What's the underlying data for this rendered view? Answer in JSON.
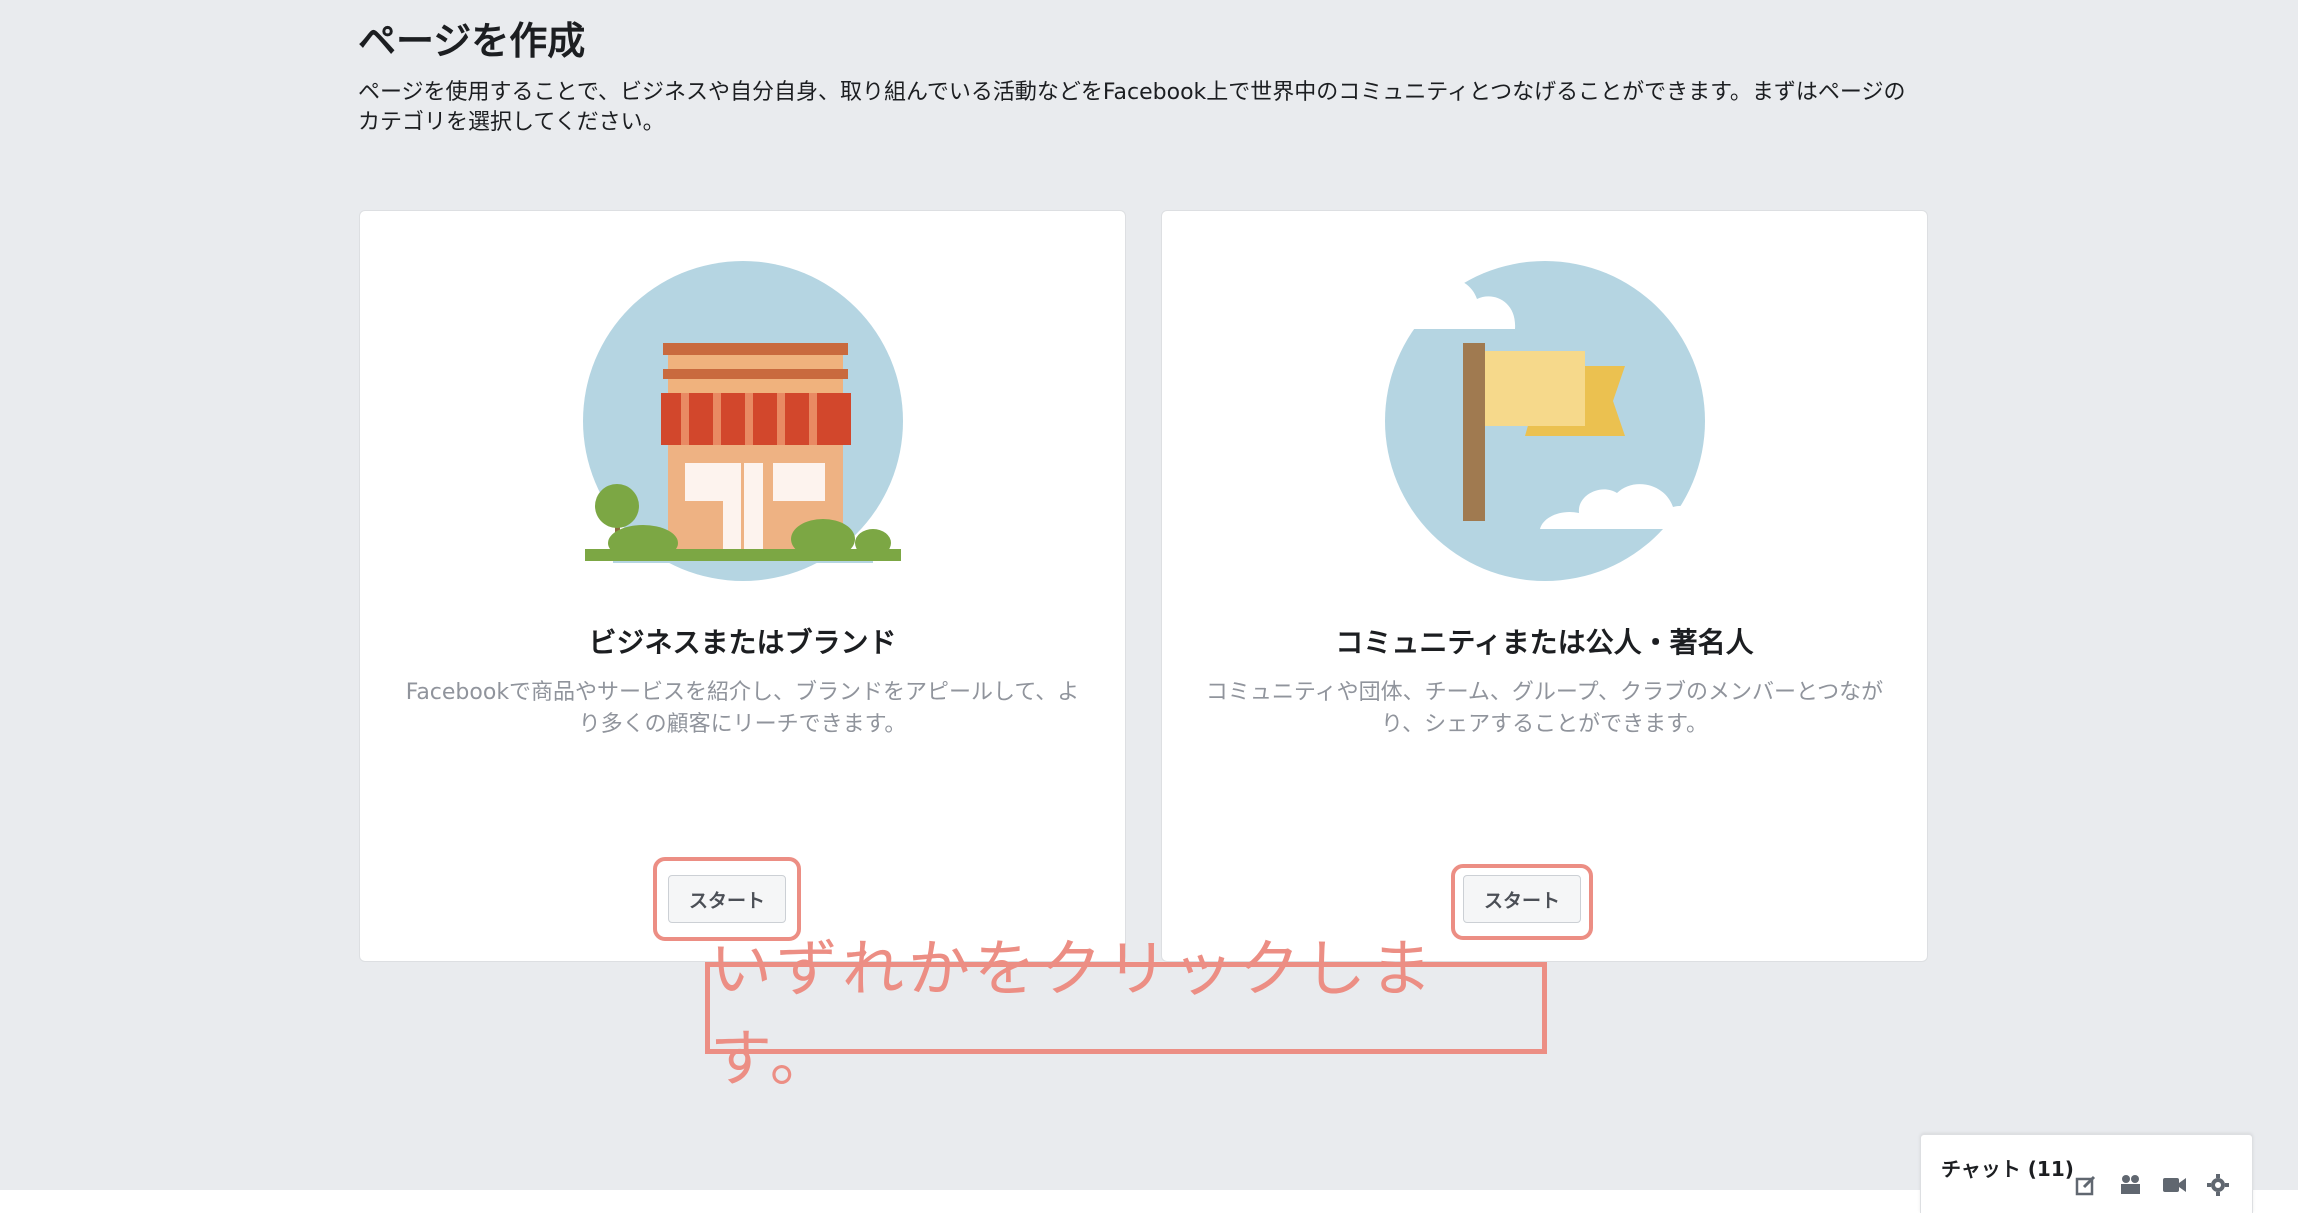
{
  "header": {
    "title": "ページを作成",
    "description": "ページを使用することで、ビジネスや自分自身、取り組んでいる活動などをFacebook上で世界中のコミュニティとつなげることができます。まずはページのカテゴリを選択してください。"
  },
  "cards": [
    {
      "title": "ビジネスまたはブランド",
      "description": "Facebookで商品やサービスを紹介し、ブランドをアピールして、より多くの顧客にリーチできます。",
      "button_label": "スタート",
      "icon": "storefront-illustration"
    },
    {
      "title": "コミュニティまたは公人・著名人",
      "description": "コミュニティや団体、チーム、グループ、クラブのメンバーとつながり、シェアすることができます。",
      "button_label": "スタート",
      "icon": "flag-illustration"
    }
  ],
  "annotation": {
    "text": "いずれかをクリックします。",
    "color": "#ec8e84"
  },
  "chat": {
    "label": "チャット (11)",
    "icons": [
      "compose-icon",
      "contacts-icon",
      "video-icon",
      "settings-icon"
    ]
  },
  "colors": {
    "background": "#e9ebee",
    "card": "#ffffff",
    "highlight": "#ec8e84"
  }
}
